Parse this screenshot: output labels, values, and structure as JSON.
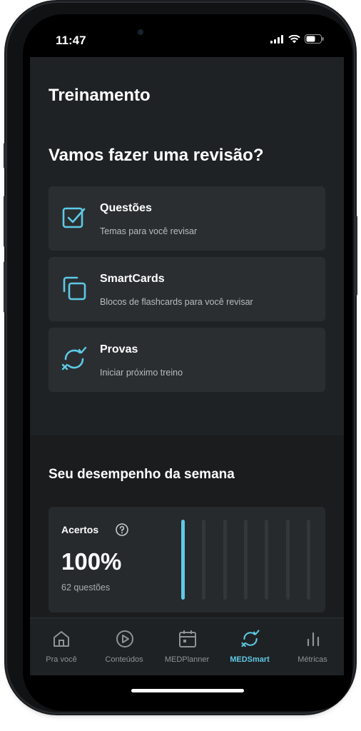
{
  "status": {
    "time": "11:47"
  },
  "header": {
    "title": "Treinamento"
  },
  "review": {
    "title": "Vamos fazer uma revisão?",
    "cards": [
      {
        "title": "Questões",
        "subtitle": "Temas para você revisar",
        "icon": "checkbox-icon"
      },
      {
        "title": "SmartCards",
        "subtitle": "Blocos de flashcards para você revisar",
        "icon": "cards-icon"
      },
      {
        "title": "Provas",
        "subtitle": "Iniciar próximo treino",
        "icon": "cycle-icon"
      }
    ]
  },
  "performance": {
    "title": "Seu desempenho da semana",
    "label": "Acertos",
    "value": "100%",
    "count": "62 questões",
    "bars": [
      1.0,
      0,
      0,
      0,
      0,
      0,
      0
    ]
  },
  "tabs": [
    {
      "label": "Pra você",
      "icon": "home-icon"
    },
    {
      "label": "Conteúdos",
      "icon": "play-icon"
    },
    {
      "label": "MEDPlanner",
      "icon": "calendar-icon"
    },
    {
      "label": "MEDSmart",
      "icon": "medsmart-icon",
      "active": true
    },
    {
      "label": "Métricas",
      "icon": "bar-chart-icon"
    }
  ],
  "colors": {
    "accent": "#5ec9e6",
    "background": "#1f2224",
    "card": "#2a2e31"
  }
}
